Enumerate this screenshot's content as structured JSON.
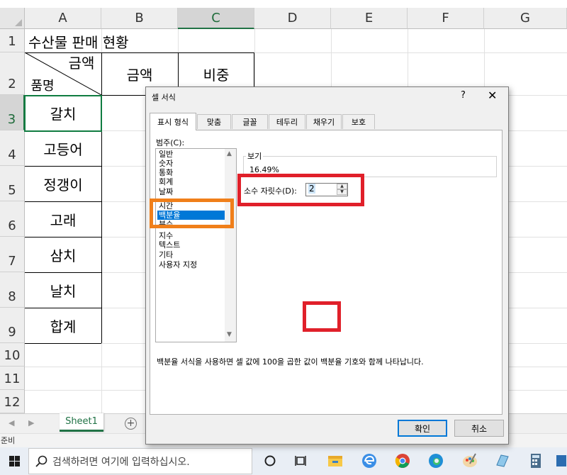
{
  "spreadsheet": {
    "columns": [
      "A",
      "B",
      "C",
      "D",
      "E",
      "F",
      "G"
    ],
    "rows": [
      "1",
      "2",
      "3",
      "4",
      "5",
      "6",
      "7",
      "8",
      "9",
      "10",
      "11",
      "12"
    ],
    "title": "수산물 판매 현황",
    "header_diag_top": "금액",
    "header_diag_bottom": "품명",
    "header_b": "금액",
    "header_c": "비중",
    "items": [
      "갈치",
      "고등어",
      "정갱이",
      "고래",
      "삼치",
      "날치",
      "합계"
    ],
    "sheet_tab": "Sheet1",
    "status": "준비"
  },
  "taskbar": {
    "search_placeholder": "검색하려면 여기에 입력하십시오."
  },
  "dialog": {
    "title": "셀 서식",
    "help": "?",
    "close": "✕",
    "tabs": [
      "표시 형식",
      "맞춤",
      "글꼴",
      "테두리",
      "채우기",
      "보호"
    ],
    "category_label": "범주(C):",
    "categories": [
      "일반",
      "숫자",
      "통화",
      "회계",
      "날짜",
      "시간",
      "백분율",
      "분수",
      "지수",
      "텍스트",
      "기타",
      "사용자 지정"
    ],
    "selected_category": "백분율",
    "sample_label": "보기",
    "sample_value": "16.49%",
    "decimal_label": "소수 자릿수(D):",
    "decimal_value": "2",
    "description": "백분율 서식을 사용하면 셀 값에 100을 곱한 값이 백분율 기호와 함께 나타납니다.",
    "ok": "확인",
    "cancel": "취소"
  },
  "colors": {
    "excel_green": "#217346",
    "selection_blue": "#0078d7",
    "annotation_red": "#e0202a",
    "annotation_orange": "#f07f1a"
  }
}
